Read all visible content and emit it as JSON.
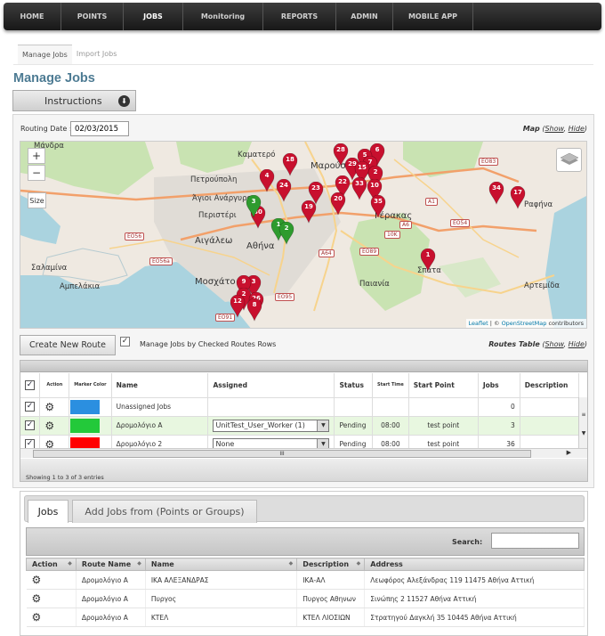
{
  "nav": {
    "items": [
      "HOME",
      "POINTS",
      "JOBS",
      "Monitoring",
      "REPORTS",
      "ADMIN",
      "MOBILE APP"
    ],
    "active": "JOBS"
  },
  "subnav": {
    "items": [
      "Manage Jobs",
      "Import Jobs"
    ],
    "active": "Manage Jobs"
  },
  "page": {
    "title": "Manage Jobs",
    "instructions_label": "Instructions"
  },
  "routing": {
    "label": "Routing Date :",
    "date": "02/03/2015"
  },
  "map": {
    "label": "Map",
    "show": "Show",
    "hide": "Hide",
    "zoom_in": "+",
    "zoom_out": "−",
    "size_btn": "Size",
    "attribution_leaflet": "Leaflet",
    "attribution_sep": " | © ",
    "attribution_osm": "OpenStreetMap",
    "attribution_tail": " contributors",
    "places": [
      "Μάνδρα",
      "Καματερό",
      "Πετρούπολη",
      "Άγιοι Ανάργυροι",
      "Περιστέρι",
      "Αιγάλεω",
      "Αθήνα",
      "Σαλαμίνα",
      "Αμπελάκια",
      "Μοσχάτο",
      "Παιανία",
      "Σπάτα",
      "Αρτεμίδα",
      "Ραφήνα",
      "Γέρακας",
      "Μαρούσι"
    ],
    "road_labels": [
      "EO56a",
      "EO56",
      "EO83",
      "EO54",
      "EO89",
      "EO91",
      "EO95",
      "A64",
      "A6",
      "10K",
      "A1"
    ],
    "markers": {
      "red": [
        "28",
        "6",
        "5",
        "7",
        "29",
        "15",
        "18",
        "2",
        "4",
        "22",
        "23",
        "33",
        "10",
        "24",
        "19",
        "20",
        "35",
        "30",
        "34",
        "17",
        "1",
        "3",
        "9",
        "2",
        "12",
        "26",
        "8"
      ],
      "green": [
        "3",
        "1",
        "2"
      ]
    }
  },
  "routes_toolbar": {
    "create_button": "Create New Route",
    "manage_label": "Manage Jobs by Checked Routes Rows",
    "table_label": "Routes Table",
    "show": "Show",
    "hide": "Hide"
  },
  "routes_table": {
    "columns": [
      "",
      "Action",
      "Marker Color",
      "Name",
      "Assigned",
      "Status",
      "Start Time",
      "Start Point",
      "Jobs",
      "Description"
    ],
    "rows": [
      {
        "name": "Unassigned Jobs",
        "color": "#2b8fe0",
        "assigned": "",
        "status": "",
        "start_time": "",
        "start_point": "",
        "jobs": "0"
      },
      {
        "name": "Δρομολόγιο Α",
        "color": "#23c93a",
        "assigned": "UnitTest_User_Worker (1)",
        "status": "Pending",
        "start_time": "08:00",
        "start_point": "test point",
        "jobs": "3"
      },
      {
        "name": "Δρομολόγιο 2",
        "color": "#ff0000",
        "assigned": "None",
        "status": "Pending",
        "start_time": "08:00",
        "start_point": "test point",
        "jobs": "36"
      }
    ],
    "footer": "Showing 1 to 3 of 3 entries",
    "scroll_grip": "III"
  },
  "jobs_panel": {
    "tabs": [
      "Jobs",
      "Add Jobs from (Points or Groups)"
    ],
    "active_tab": "Jobs",
    "search_label": "Search:",
    "search_value": "",
    "columns": [
      "Action",
      "Route Name",
      "Name",
      "Description",
      "Address"
    ],
    "rows": [
      {
        "route": "Δρομολόγιο Α",
        "name": "ΙΚΑ ΑΛΕΞΑΝΔΡΑΣ",
        "description": "ΙΚΑ-ΑΛ",
        "address": "Λεωφόρος Αλεξάνδρας 119 11475 Αθήνα Αττική"
      },
      {
        "route": "Δρομολόγιο Α",
        "name": "Πυργος",
        "description": "Πυργος Αθηνων",
        "address": "Σινώπης 2 11527 Αθήνα Αττική"
      },
      {
        "route": "Δρομολόγιο Α",
        "name": "ΚΤΕΛ",
        "description": "ΚΤΕΛ ΛΙΟΣΙΩΝ",
        "address": "Στρατηγού Δαγκλή 35 10445 Αθήνα Αττική"
      }
    ]
  },
  "colors": {
    "title": "#4d7b93",
    "marker_red": "#c8102e",
    "marker_green": "#2e9b2e",
    "map_land": "#efe9e1",
    "map_sea": "#aad3df",
    "map_green": "#c9e3b2"
  }
}
